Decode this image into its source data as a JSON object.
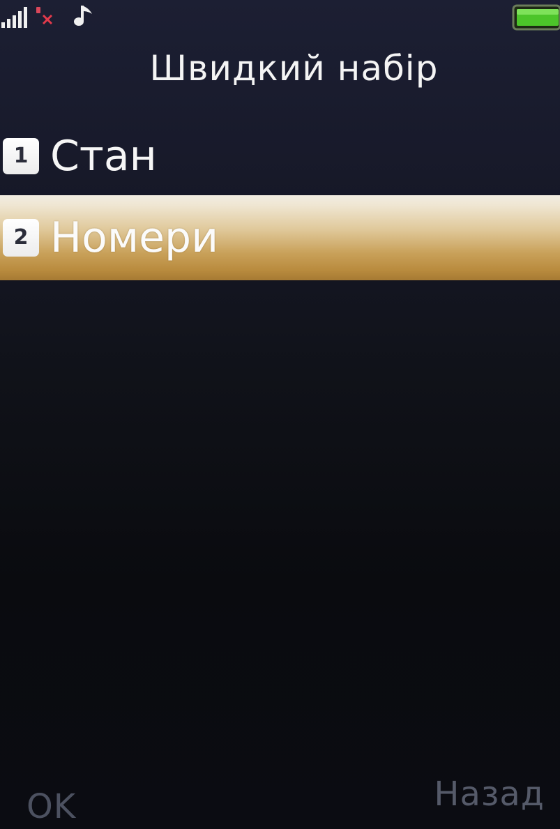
{
  "status_bar": {
    "icons": [
      "signal-icon",
      "no-sim-icon",
      "music-icon",
      "battery-icon"
    ],
    "battery_level": 1.0,
    "signal_bars": 5
  },
  "header": {
    "title": "Швидкий набір"
  },
  "menu": {
    "items": [
      {
        "number": "1",
        "label": "Стан",
        "selected": false
      },
      {
        "number": "2",
        "label": "Номери",
        "selected": true
      }
    ]
  },
  "softkeys": {
    "left": "OK",
    "right": "Назад"
  },
  "colors": {
    "background": "#151826",
    "highlight_top": "#f1ede2",
    "highlight_bottom": "#b98b3e",
    "battery_fill": "#4cc52a",
    "text": "#f4f4f4",
    "softkey_text": "#505566"
  }
}
